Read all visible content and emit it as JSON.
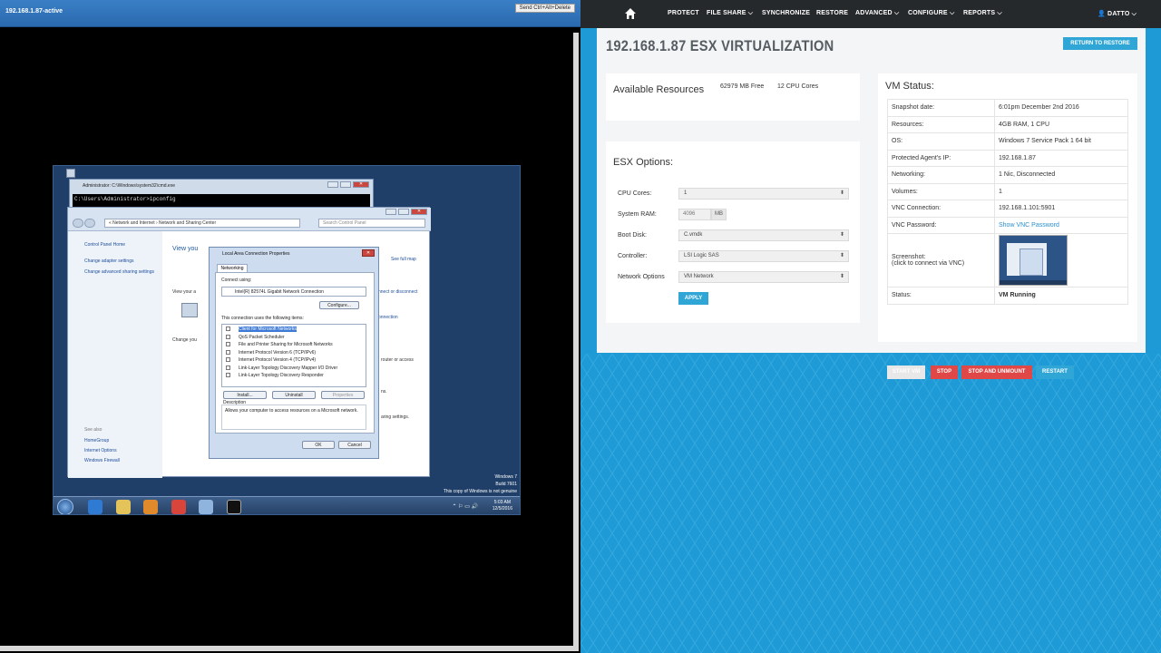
{
  "vnc": {
    "title": "192.168.1.87-active",
    "cad_button": "Send Ctrl+Alt+Delete",
    "cmd": {
      "title": "Administrator: C:\\Windows\\system32\\cmd.exe",
      "line": "C:\\Users\\Administrator>ipconfig"
    },
    "nsc": {
      "address": "« Network and Internet › Network and Sharing Center",
      "search_placeholder": "Search Control Panel",
      "left_links": [
        "Control Panel Home",
        "Change adapter settings",
        "Change advanced sharing settings"
      ],
      "see_also_label": "See also",
      "see_also": [
        "HomeGroup",
        "Internet Options",
        "Windows Firewall"
      ],
      "view_heading": "View you",
      "see_full_map": "See full map",
      "connect_disconnect": "nnect or disconnect",
      "connection": "onnection",
      "router_access": "router or access",
      "view_your_a": "View your a",
      "change_you": "Change you",
      "ns": "ns.",
      "sharing_settings": "aring settings."
    },
    "props": {
      "title": "Local Area Connection Properties",
      "tab": "Networking",
      "connect_using_label": "Connect using:",
      "adapter": "Intel(R) 82574L Gigabit Network Connection",
      "configure": "Configure...",
      "items_label": "This connection uses the following items:",
      "items": [
        "Client for Microsoft Networks",
        "QoS Packet Scheduler",
        "File and Printer Sharing for Microsoft Networks",
        "Internet Protocol Version 6 (TCP/IPv6)",
        "Internet Protocol Version 4 (TCP/IPv4)",
        "Link-Layer Topology Discovery Mapper I/O Driver",
        "Link-Layer Topology Discovery Responder"
      ],
      "install": "Install...",
      "uninstall": "Uninstall",
      "properties": "Properties",
      "description_label": "Description",
      "description": "Allows your computer to access resources on a Microsoft network.",
      "ok": "OK",
      "cancel": "Cancel"
    },
    "watermark": [
      "Windows 7",
      "Build 7601",
      "This copy of Windows is not genuine"
    ],
    "clock_time": "5:03 AM",
    "clock_date": "12/5/2016"
  },
  "nav": {
    "items": [
      "PROTECT",
      "FILE SHARE ⌵",
      "SYNCHRONIZE",
      "RESTORE",
      "ADVANCED ⌵",
      "CONFIGURE ⌵",
      "REPORTS ⌵"
    ],
    "user": "👤 DATTO ⌵"
  },
  "page": {
    "title": "192.168.1.87 ESX VIRTUALIZATION",
    "return_button": "RETURN TO RESTORE"
  },
  "resources": {
    "heading": "Available Resources",
    "free": "62979 MB Free",
    "cpu": "12 CPU Cores"
  },
  "esx": {
    "heading": "ESX Options:",
    "cpu_label": "CPU Cores:",
    "cpu_value": "1",
    "ram_label": "System RAM:",
    "ram_value": "4096",
    "ram_unit": "MB",
    "boot_label": "Boot Disk:",
    "boot_value": "C.vmdk",
    "controller_label": "Controller:",
    "controller_value": "LSI Logic SAS",
    "network_label": "Network Options",
    "network_value": "VM Network",
    "apply": "APPLY"
  },
  "vm": {
    "heading": "VM Status:",
    "rows": [
      {
        "key": "Snapshot date:",
        "value": "6:01pm December 2nd 2016"
      },
      {
        "key": "Resources:",
        "value": "4GB RAM, 1 CPU"
      },
      {
        "key": "OS:",
        "value": "Windows 7 Service Pack 1 64 bit"
      },
      {
        "key": "Protected Agent's IP:",
        "value": "192.168.1.87"
      },
      {
        "key": "Networking:",
        "value": "1 Nic, Disconnected"
      },
      {
        "key": "Volumes:",
        "value": "1"
      },
      {
        "key": "VNC Connection:",
        "value": "192.168.1.101:5901"
      },
      {
        "key": "VNC Password:",
        "value": "Show VNC Password"
      }
    ],
    "screenshot_label": "Screenshot:",
    "screenshot_hint": "(click to connect via VNC)",
    "status_label": "Status:",
    "status_value": "VM Running",
    "buttons": {
      "start": "START VM",
      "stop": "STOP",
      "stop_unmount": "STOP AND UNMOUNT",
      "restart": "RESTART"
    },
    "colors": {
      "primary": "#2fa6d5",
      "danger": "#e04848",
      "disabled": "#e8e8e8"
    }
  }
}
